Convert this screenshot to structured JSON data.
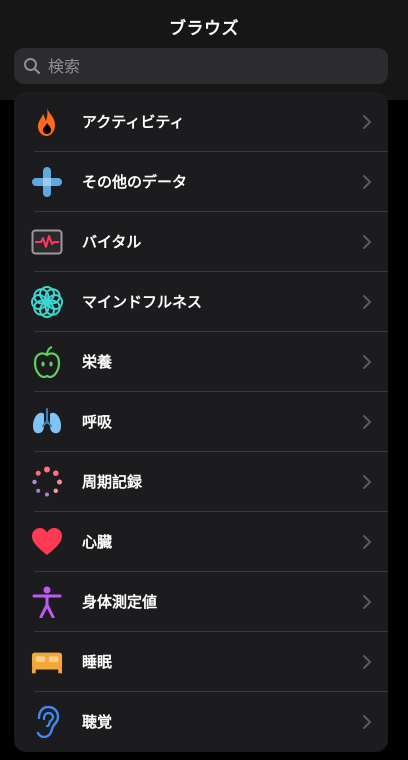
{
  "header": {
    "title": "ブラウズ"
  },
  "search": {
    "placeholder": "検索"
  },
  "categories": [
    {
      "label": "アクティビティ",
      "icon": "flame-icon",
      "color": "#ff6a1f"
    },
    {
      "label": "その他のデータ",
      "icon": "plus-cross-icon",
      "color": "#5fa9e0"
    },
    {
      "label": "バイタル",
      "icon": "vitals-monitor-icon",
      "color": "#ff375f"
    },
    {
      "label": "マインドフルネス",
      "icon": "mindfulness-flower-icon",
      "color": "#3dd6d0"
    },
    {
      "label": "栄養",
      "icon": "apple-icon",
      "color": "#5fd35d"
    },
    {
      "label": "呼吸",
      "icon": "lungs-icon",
      "color": "#7fc4f5"
    },
    {
      "label": "周期記録",
      "icon": "cycle-dots-icon",
      "color": "#ff6f7c"
    },
    {
      "label": "心臓",
      "icon": "heart-icon",
      "color": "#ff3b54"
    },
    {
      "label": "身体測定値",
      "icon": "body-figure-icon",
      "color": "#bf5af2"
    },
    {
      "label": "睡眠",
      "icon": "bed-icon",
      "color": "#f4a83a"
    },
    {
      "label": "聴覚",
      "icon": "ear-icon",
      "color": "#3f8cf0"
    }
  ]
}
